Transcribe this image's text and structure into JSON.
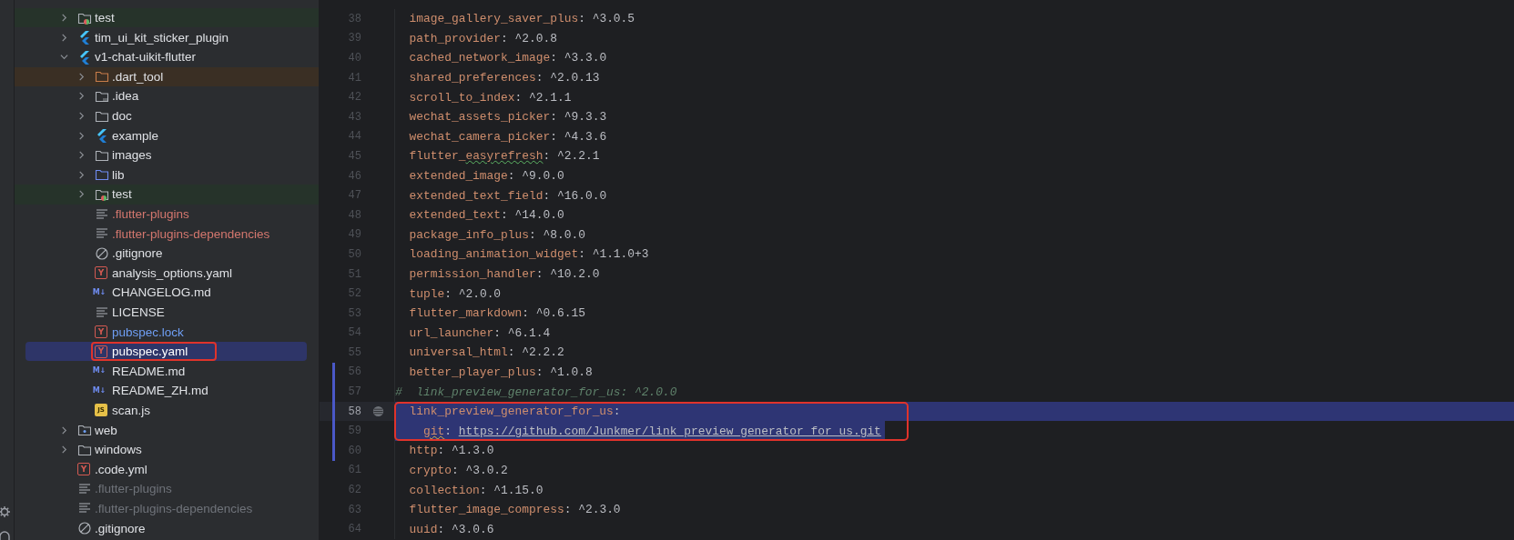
{
  "project_tree": [
    {
      "label": "test",
      "kind": "test-folder",
      "expanded": false,
      "selected": false,
      "outlined": false,
      "color": "#dfe1e5"
    },
    {
      "label": "tim_ui_kit_sticker_plugin",
      "kind": "flutter",
      "expanded": false,
      "selected": false,
      "outlined": false,
      "color": "#dfe1e5"
    },
    {
      "label": "v1-chat-uikit-flutter",
      "kind": "flutter",
      "expanded": true,
      "selected": false,
      "outlined": false,
      "color": "#dfe1e5",
      "children": [
        {
          "label": ".dart_tool",
          "kind": "excluded-folder",
          "expanded": false,
          "selected": false,
          "outlined": false,
          "color": "#dfe1e5"
        },
        {
          "label": ".idea",
          "kind": "idea-folder",
          "expanded": false,
          "selected": false,
          "outlined": false,
          "color": "#dfe1e5"
        },
        {
          "label": "doc",
          "kind": "folder",
          "expanded": false,
          "selected": false,
          "outlined": false,
          "color": "#dfe1e5"
        },
        {
          "label": "example",
          "kind": "flutter",
          "expanded": false,
          "selected": false,
          "outlined": false,
          "color": "#dfe1e5"
        },
        {
          "label": "images",
          "kind": "folder",
          "expanded": false,
          "selected": false,
          "outlined": false,
          "color": "#dfe1e5"
        },
        {
          "label": "lib",
          "kind": "source-folder",
          "expanded": false,
          "selected": false,
          "outlined": false,
          "color": "#dfe1e5"
        },
        {
          "label": "test",
          "kind": "test-folder",
          "expanded": false,
          "selected": false,
          "outlined": false,
          "color": "#dfe1e5"
        },
        {
          "label": ".flutter-plugins",
          "kind": "text",
          "selected": false,
          "outlined": false,
          "color": "#d4776e"
        },
        {
          "label": ".flutter-plugins-dependencies",
          "kind": "text",
          "selected": false,
          "outlined": false,
          "color": "#d4776e"
        },
        {
          "label": ".gitignore",
          "kind": "ignore",
          "selected": false,
          "outlined": false,
          "color": "#dfe1e5"
        },
        {
          "label": "analysis_options.yaml",
          "kind": "yaml",
          "icon_text": "Y",
          "selected": false,
          "outlined": false,
          "color": "#dfe1e5"
        },
        {
          "label": "CHANGELOG.md",
          "kind": "markdown",
          "icon_text": "M↓",
          "selected": false,
          "outlined": false,
          "color": "#dfe1e5"
        },
        {
          "label": "LICENSE",
          "kind": "text",
          "selected": false,
          "outlined": false,
          "color": "#dfe1e5"
        },
        {
          "label": "pubspec.lock",
          "kind": "yaml",
          "icon_text": "Y",
          "selected": false,
          "outlined": false,
          "color": "#6f9ff5"
        },
        {
          "label": "pubspec.yaml",
          "kind": "yaml",
          "icon_text": "Y",
          "selected": true,
          "outlined": true
        },
        {
          "label": "README.md",
          "kind": "markdown",
          "icon_text": "M↓",
          "selected": false,
          "outlined": false,
          "color": "#dfe1e5"
        },
        {
          "label": "README_ZH.md",
          "kind": "markdown",
          "icon_text": "M↓",
          "selected": false,
          "outlined": false,
          "color": "#dfe1e5"
        },
        {
          "label": "scan.js",
          "kind": "js",
          "icon_text": "JS",
          "selected": false,
          "outlined": false,
          "color": "#dfe1e5"
        }
      ]
    },
    {
      "label": "web",
      "kind": "web-folder",
      "expanded": false,
      "selected": false,
      "outlined": false,
      "color": "#dfe1e5"
    },
    {
      "label": "windows",
      "kind": "folder",
      "expanded": false,
      "selected": false,
      "outlined": false,
      "color": "#dfe1e5"
    },
    {
      "label": ".code.yml",
      "kind": "yaml",
      "icon_text": "Y",
      "selected": false,
      "outlined": false,
      "color": "#dfe1e5"
    },
    {
      "label": ".flutter-plugins",
      "kind": "text",
      "selected": false,
      "outlined": false,
      "color": "#6f737a"
    },
    {
      "label": ".flutter-plugins-dependencies",
      "kind": "text",
      "selected": false,
      "outlined": false,
      "color": "#6f737a"
    },
    {
      "label": ".gitignore",
      "kind": "ignore",
      "selected": false,
      "outlined": false,
      "color": "#dfe1e5"
    }
  ],
  "editor": {
    "lines": [
      {
        "number": "38",
        "kind": "entry",
        "key": "image_gallery_saver_plus:",
        "value": "^3.0.5",
        "selected": false,
        "current": false,
        "changed": false,
        "outlined": false
      },
      {
        "number": "39",
        "kind": "entry",
        "key": "path_provider:",
        "value": "^2.0.8",
        "selected": false,
        "current": false,
        "changed": false,
        "outlined": false
      },
      {
        "number": "40",
        "kind": "entry",
        "key": "cached_network_image:",
        "value": "^3.3.0",
        "selected": false,
        "current": false,
        "changed": false,
        "outlined": false
      },
      {
        "number": "41",
        "kind": "entry",
        "key": "shared_preferences:",
        "value": "^2.0.13",
        "selected": false,
        "current": false,
        "changed": false,
        "outlined": false
      },
      {
        "number": "42",
        "kind": "entry",
        "key": "scroll_to_index:",
        "value": "^2.1.1",
        "selected": false,
        "current": false,
        "changed": false,
        "outlined": false
      },
      {
        "number": "43",
        "kind": "entry",
        "key": "wechat_assets_picker:",
        "value": "^9.3.3",
        "selected": false,
        "current": false,
        "changed": false,
        "outlined": false
      },
      {
        "number": "44",
        "kind": "entry",
        "key": "wechat_camera_picker:",
        "value": "^4.3.6",
        "selected": false,
        "current": false,
        "changed": false,
        "outlined": false
      },
      {
        "number": "45",
        "kind": "entry",
        "key": "flutter_",
        "flagged": "easyrefresh",
        "warning": false,
        "key_end": ":",
        "value": "^2.2.1",
        "selected": false,
        "current": false,
        "changed": false,
        "outlined": false
      },
      {
        "number": "46",
        "kind": "entry",
        "key": "extended_image:",
        "value": "^9.0.0",
        "selected": false,
        "current": false,
        "changed": false,
        "outlined": false
      },
      {
        "number": "47",
        "kind": "entry",
        "key": "extended_text_field:",
        "value": "^16.0.0",
        "selected": false,
        "current": false,
        "changed": false,
        "outlined": false
      },
      {
        "number": "48",
        "kind": "entry",
        "key": "extended_text:",
        "value": "^14.0.0",
        "selected": false,
        "current": false,
        "changed": false,
        "outlined": false
      },
      {
        "number": "49",
        "kind": "entry",
        "key": "package_info_plus:",
        "value": "^8.0.0",
        "selected": false,
        "current": false,
        "changed": false,
        "outlined": false
      },
      {
        "number": "50",
        "kind": "entry",
        "key": "loading_animation_widget:",
        "value": "^1.1.0+3",
        "selected": false,
        "current": false,
        "changed": false,
        "outlined": false
      },
      {
        "number": "51",
        "kind": "entry",
        "key": "permission_handler:",
        "value": "^10.2.0",
        "selected": false,
        "current": false,
        "changed": false,
        "outlined": false
      },
      {
        "number": "52",
        "kind": "entry",
        "key": "tuple:",
        "value": "^2.0.0",
        "selected": false,
        "current": false,
        "changed": false,
        "outlined": false
      },
      {
        "number": "53",
        "kind": "entry",
        "key": "flutter_markdown:",
        "value": "^0.6.15",
        "selected": false,
        "current": false,
        "changed": false,
        "outlined": false
      },
      {
        "number": "54",
        "kind": "entry",
        "key": "url_launcher:",
        "value": "^6.1.4",
        "selected": false,
        "current": false,
        "changed": false,
        "outlined": false
      },
      {
        "number": "55",
        "kind": "entry",
        "key": "universal_html:",
        "value": "^2.2.2",
        "selected": false,
        "current": false,
        "changed": false,
        "outlined": false
      },
      {
        "number": "56",
        "kind": "entry",
        "key": "better_player_plus:",
        "value": "^1.0.8",
        "selected": false,
        "current": false,
        "changed": true,
        "outlined": false
      },
      {
        "number": "57",
        "kind": "comment",
        "text": "#  link_preview_generator_for_us: ^2.0.0",
        "selected": false,
        "current": false,
        "changed": true,
        "outlined": false
      },
      {
        "number": "58",
        "kind": "entry",
        "key": "link_preview_generator_for_us:",
        "selected": true,
        "current": true,
        "changed": true,
        "outlined": true
      },
      {
        "number": "59",
        "kind": "nested",
        "flagged": "git",
        "warning": true,
        "key_end": ":",
        "link": "https://github.com/Junkmer/link_preview_generator_for_us.git",
        "selected": true,
        "current": false,
        "changed": true,
        "outlined": true
      },
      {
        "number": "60",
        "kind": "entry",
        "key": "http:",
        "value": "^1.3.0",
        "selected": false,
        "current": false,
        "changed": true,
        "outlined": false
      },
      {
        "number": "61",
        "kind": "entry",
        "key": "crypto:",
        "value": "^3.0.2",
        "selected": false,
        "current": false,
        "changed": false,
        "outlined": false
      },
      {
        "number": "62",
        "kind": "entry",
        "key": "collection:",
        "value": "^1.15.0",
        "selected": false,
        "current": false,
        "changed": false,
        "outlined": false
      },
      {
        "number": "63",
        "kind": "entry",
        "key": "flutter_image_compress:",
        "value": "^2.3.0",
        "selected": false,
        "current": false,
        "changed": false,
        "outlined": false
      },
      {
        "number": "64",
        "kind": "entry",
        "key": "uuid:",
        "value": "^3.0.6",
        "selected": false,
        "current": false,
        "changed": false,
        "outlined": false
      }
    ]
  }
}
